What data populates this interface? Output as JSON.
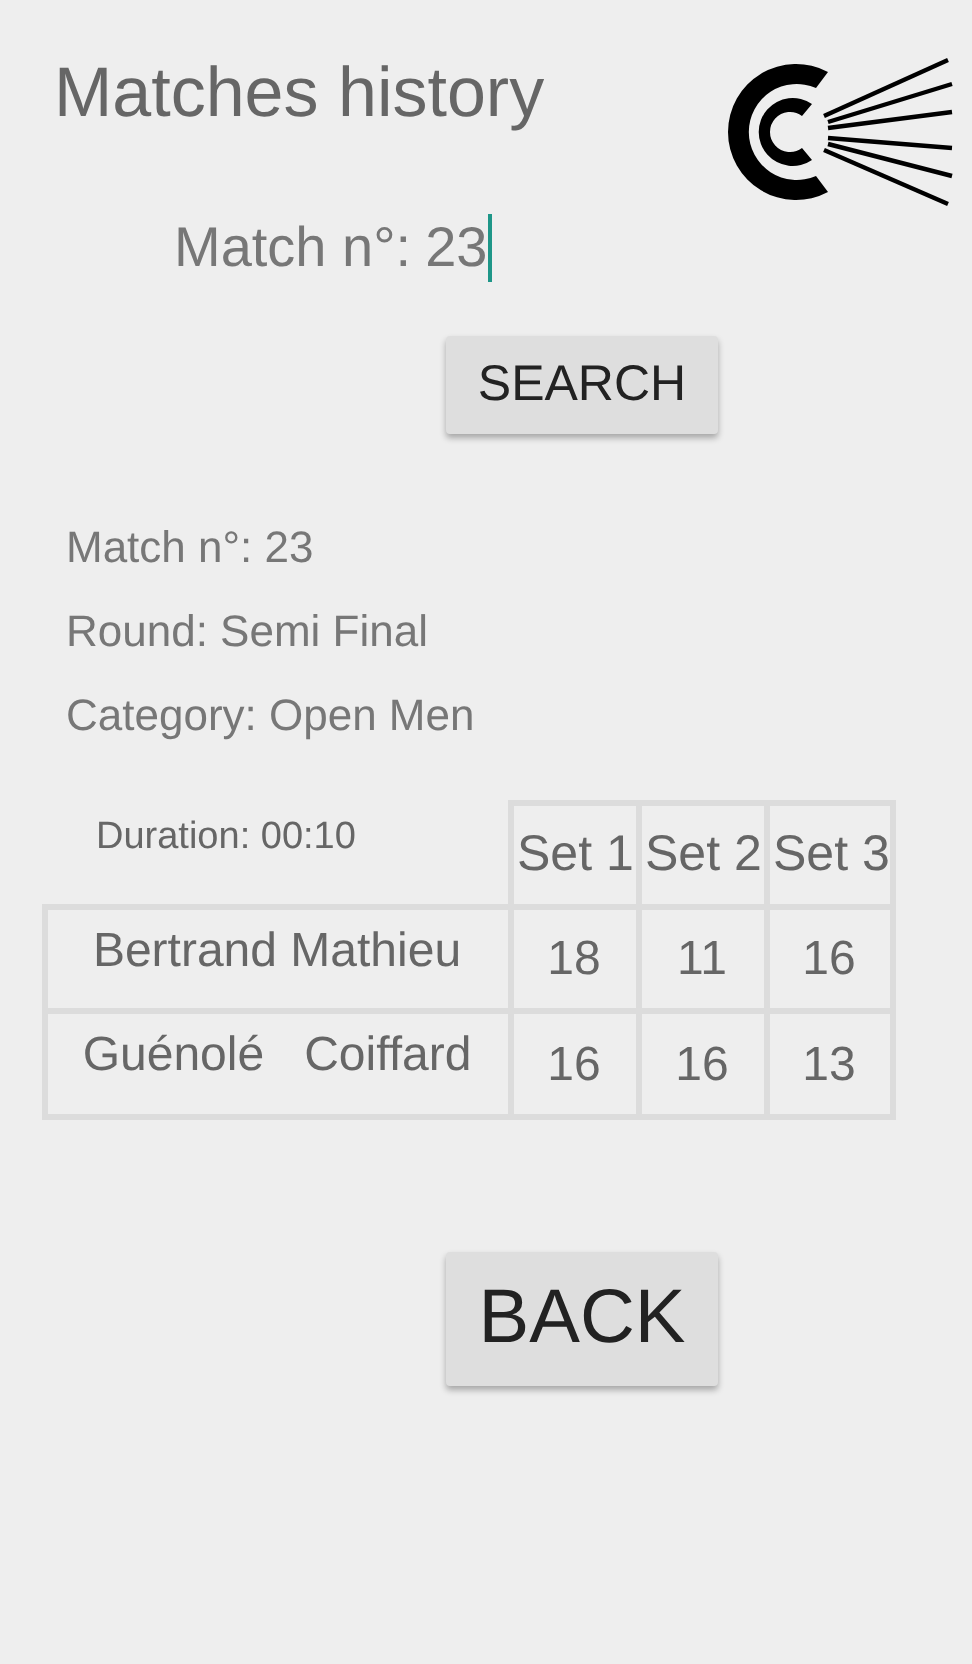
{
  "title": "Matches history",
  "search": {
    "label": "Match n°:",
    "value": "23",
    "button": "SEARCH"
  },
  "info": [
    "Match n°: 23",
    "Round: Semi Final",
    "Category: Open Men"
  ],
  "table": {
    "duration": "Duration: 00:10",
    "columns": [
      "Set 1",
      "Set 2",
      "Set 3"
    ],
    "rows": [
      {
        "player": "Bertrand Mathieu",
        "scores": [
          "18",
          "11",
          "16"
        ]
      },
      {
        "player": "Guénolé   Coiffard",
        "scores": [
          "16",
          "16",
          "13"
        ]
      }
    ]
  },
  "back_button": "BACK"
}
